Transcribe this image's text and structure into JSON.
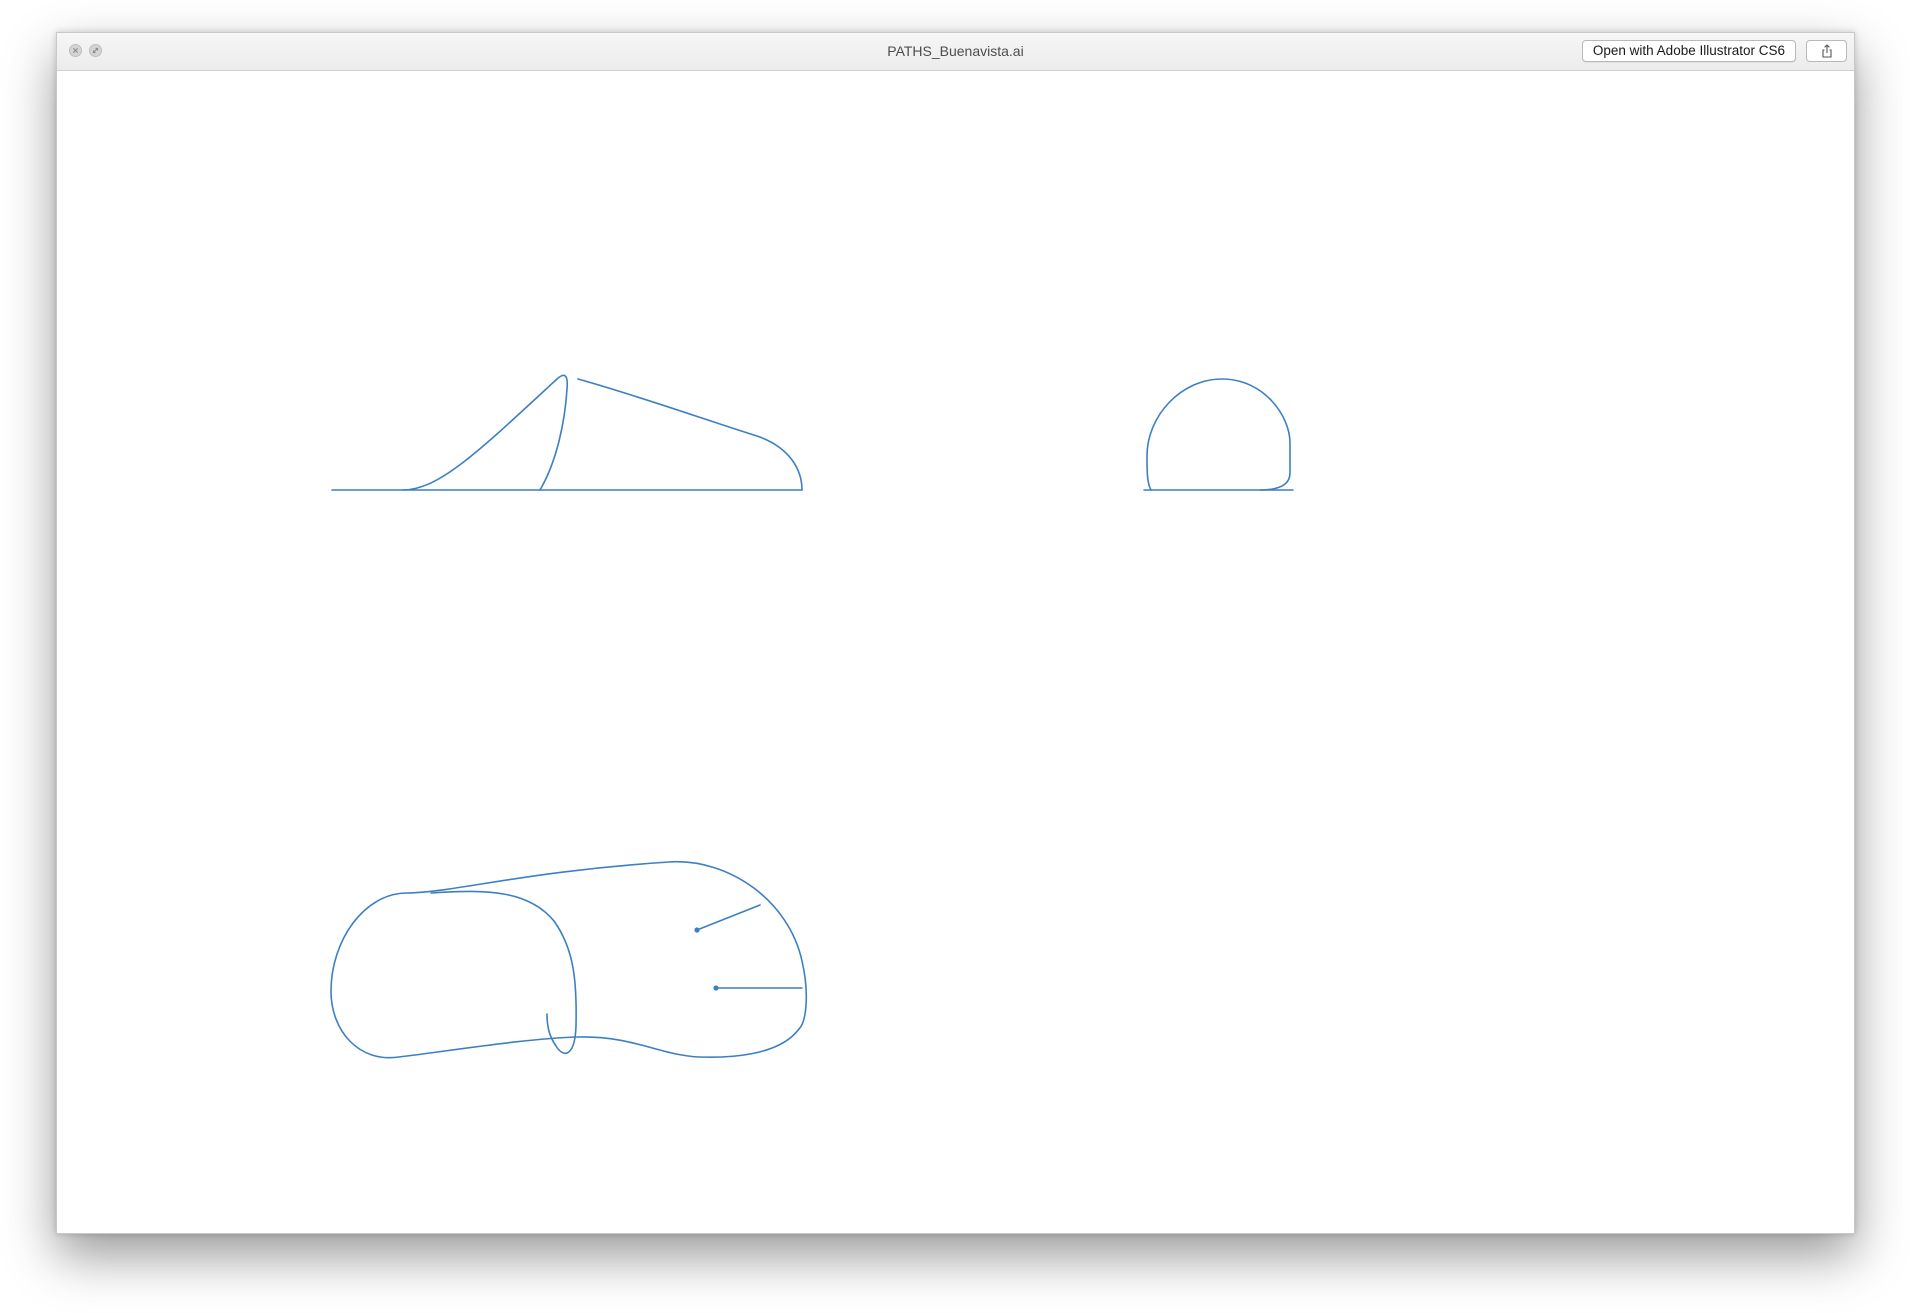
{
  "window": {
    "title": "PATHS_Buenavista.ai"
  },
  "toolbar": {
    "open_button_label": "Open with Adobe Illustrator CS6",
    "share_icon": "share-icon"
  },
  "controls": {
    "close_icon": "close-icon",
    "fullscreen_icon": "fullscreen-icon"
  },
  "canvas": {
    "background_color": "#ffffff",
    "stroke_color": "#3d7fc4",
    "shapes": [
      "profile-path",
      "arch-path",
      "outline-path"
    ]
  }
}
